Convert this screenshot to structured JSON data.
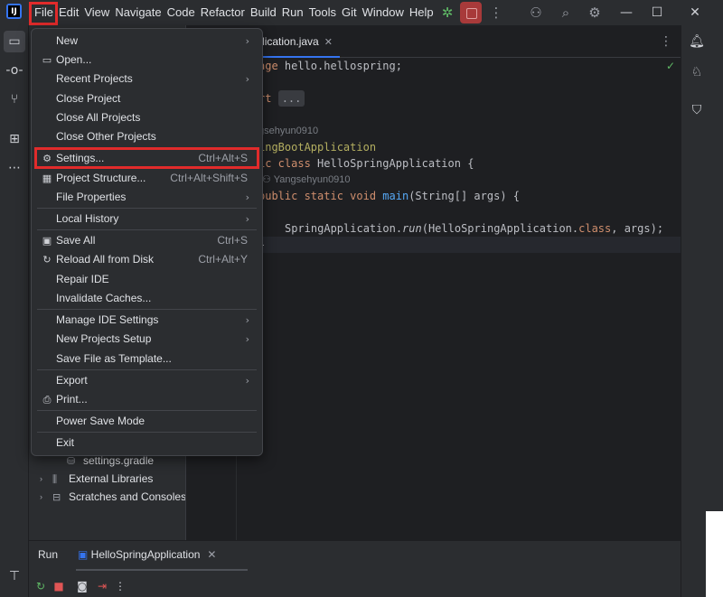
{
  "app": {
    "logo_letter": "IJ"
  },
  "menubar": {
    "items": [
      "File",
      "Edit",
      "View",
      "Navigate",
      "Code",
      "Refactor",
      "Build",
      "Run",
      "Tools",
      "Git",
      "Window",
      "Help"
    ],
    "icons": [
      "debug-icon",
      "stop-icon",
      "more-vertical-icon",
      "add-user-icon",
      "search-icon",
      "gear-icon",
      "minimize-icon",
      "maximize-icon",
      "close-icon"
    ]
  },
  "file_menu": {
    "items": [
      {
        "label": "New",
        "shortcut": "",
        "submenu": true,
        "icon": ""
      },
      {
        "label": "Open...",
        "shortcut": "",
        "submenu": false,
        "icon": "folder-icon"
      },
      {
        "label": "Recent Projects",
        "shortcut": "",
        "submenu": true,
        "icon": ""
      },
      {
        "label": "Close Project",
        "shortcut": "",
        "submenu": false,
        "icon": ""
      },
      {
        "label": "Close All Projects",
        "shortcut": "",
        "submenu": false,
        "icon": ""
      },
      {
        "label": "Close Other Projects",
        "shortcut": "",
        "submenu": false,
        "icon": ""
      },
      {
        "label": "Settings...",
        "shortcut": "Ctrl+Alt+S",
        "submenu": false,
        "icon": "gear-icon"
      },
      {
        "label": "Project Structure...",
        "shortcut": "Ctrl+Alt+Shift+S",
        "submenu": false,
        "icon": "project-structure-icon"
      },
      {
        "label": "File Properties",
        "shortcut": "",
        "submenu": true,
        "icon": ""
      },
      {
        "label": "Local History",
        "shortcut": "",
        "submenu": true,
        "icon": ""
      },
      {
        "label": "Save All",
        "shortcut": "Ctrl+S",
        "submenu": false,
        "icon": "save-icon"
      },
      {
        "label": "Reload All from Disk",
        "shortcut": "Ctrl+Alt+Y",
        "submenu": false,
        "icon": "reload-icon"
      },
      {
        "label": "Repair IDE",
        "shortcut": "",
        "submenu": false,
        "icon": ""
      },
      {
        "label": "Invalidate Caches...",
        "shortcut": "",
        "submenu": false,
        "icon": ""
      },
      {
        "label": "Manage IDE Settings",
        "shortcut": "",
        "submenu": true,
        "icon": ""
      },
      {
        "label": "New Projects Setup",
        "shortcut": "",
        "submenu": true,
        "icon": ""
      },
      {
        "label": "Save File as Template...",
        "shortcut": "",
        "submenu": false,
        "icon": ""
      },
      {
        "label": "Export",
        "shortcut": "",
        "submenu": true,
        "icon": ""
      },
      {
        "label": "Print...",
        "shortcut": "",
        "submenu": false,
        "icon": "print-icon"
      },
      {
        "label": "Power Save Mode",
        "shortcut": "",
        "submenu": false,
        "icon": ""
      },
      {
        "label": "Exit",
        "shortcut": "",
        "submenu": false,
        "icon": ""
      }
    ]
  },
  "editor": {
    "tab_title": "gApplication.java",
    "code": {
      "line1_kw": "age",
      "line1_rest": " hello.hellospring;",
      "line2_kw": "rt",
      "line2_fold": "...",
      "author_hint1": "gsehyun0910",
      "line3_ann": "ingBootApplication",
      "line4_kw": "ic class",
      "line4_rest": " HelloSpringApplication {",
      "author_hint2": "Yangsehyun0910",
      "line5_kw": "public static void",
      "line5_fn": "main",
      "line5_rest": "(String[] args) {",
      "line6_a": "SpringApplication.",
      "line6_fn": "run",
      "line6_b": "(HelloSpringApplication.",
      "line6_kw": "class",
      "line6_c": ", args);",
      "line7": "}"
    }
  },
  "project_tree": {
    "items": [
      "settings.gradle",
      "External Libraries",
      "Scratches and Consoles"
    ]
  },
  "run_panel": {
    "label": "Run",
    "config": "HelloSpringApplication"
  },
  "colors": {
    "highlight_box": "#e12b2b",
    "accent": "#3574f0"
  }
}
